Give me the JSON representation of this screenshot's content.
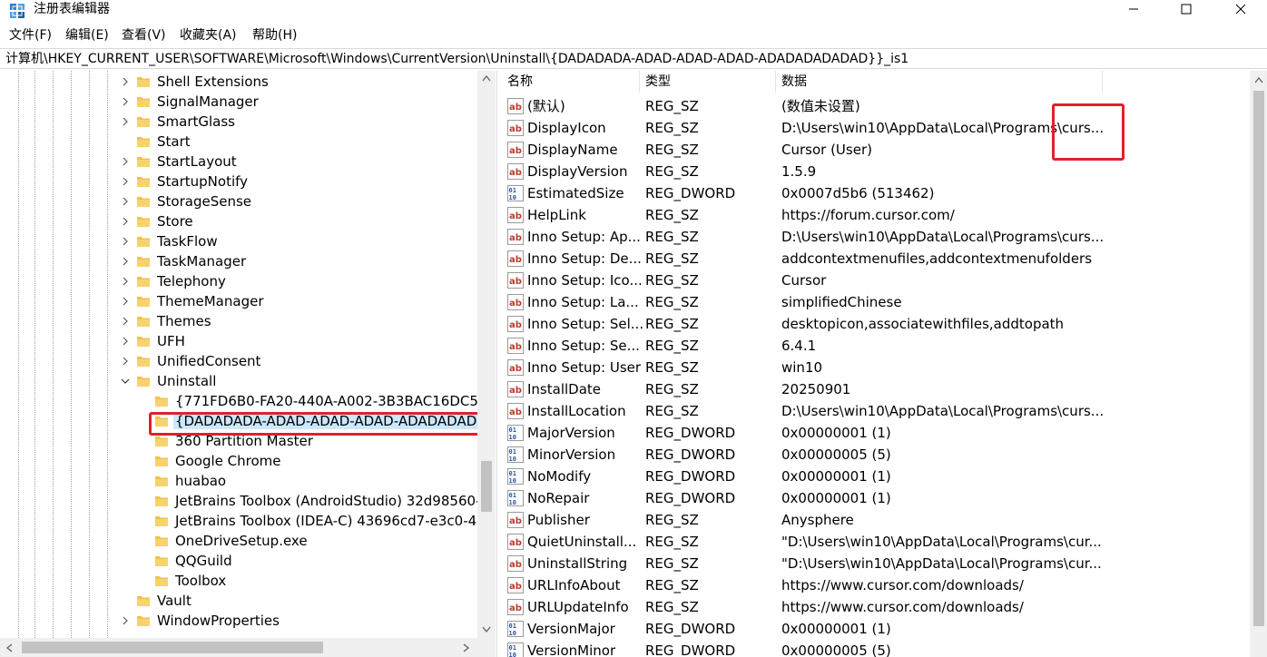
{
  "window": {
    "title": "注册表编辑器",
    "minimize_icon": "minimize-icon",
    "maximize_icon": "maximize-icon",
    "close_icon": "close-icon"
  },
  "menu": [
    {
      "label": "文件(F)"
    },
    {
      "label": "编辑(E)"
    },
    {
      "label": "查看(V)"
    },
    {
      "label": "收藏夹(A)"
    },
    {
      "label": "帮助(H)"
    }
  ],
  "address": "计算机\\HKEY_CURRENT_USER\\SOFTWARE\\Microsoft\\Windows\\CurrentVersion\\Uninstall\\{DADADADA-ADAD-ADAD-ADAD-ADADADADADAD}}_is1",
  "colors": {
    "folder": "#f2c14e",
    "selection": "#cce8ff",
    "highlight": "#e0212b",
    "string_icon": "#c0392b",
    "dword_icon": "#2455a4"
  },
  "tree": {
    "items": [
      {
        "label": "Shell Extensions",
        "expander": "collapsed"
      },
      {
        "label": "SignalManager",
        "expander": "collapsed"
      },
      {
        "label": "SmartGlass",
        "expander": "collapsed"
      },
      {
        "label": "Start",
        "expander": "none"
      },
      {
        "label": "StartLayout",
        "expander": "collapsed"
      },
      {
        "label": "StartupNotify",
        "expander": "collapsed"
      },
      {
        "label": "StorageSense",
        "expander": "collapsed"
      },
      {
        "label": "Store",
        "expander": "collapsed"
      },
      {
        "label": "TaskFlow",
        "expander": "collapsed"
      },
      {
        "label": "TaskManager",
        "expander": "collapsed"
      },
      {
        "label": "Telephony",
        "expander": "collapsed"
      },
      {
        "label": "ThemeManager",
        "expander": "collapsed"
      },
      {
        "label": "Themes",
        "expander": "collapsed"
      },
      {
        "label": "UFH",
        "expander": "collapsed"
      },
      {
        "label": "UnifiedConsent",
        "expander": "collapsed"
      },
      {
        "label": "Uninstall",
        "expander": "expanded"
      },
      {
        "label": "{771FD6B0-FA20-440A-A002-3B3BAC16DC50}",
        "expander": "none",
        "child": true
      },
      {
        "label": "{DADADADA-ADAD-ADAD-ADAD-ADADADAD",
        "expander": "none",
        "child": true,
        "selected": true
      },
      {
        "label": "360 Partition Master",
        "expander": "none",
        "child": true
      },
      {
        "label": "Google Chrome",
        "expander": "none",
        "child": true
      },
      {
        "label": "huabao",
        "expander": "none",
        "child": true
      },
      {
        "label": "JetBrains Toolbox (AndroidStudio) 32d98560-",
        "expander": "none",
        "child": true
      },
      {
        "label": "JetBrains Toolbox (IDEA-C) 43696cd7-e3c0-40",
        "expander": "none",
        "child": true
      },
      {
        "label": "OneDriveSetup.exe",
        "expander": "none",
        "child": true
      },
      {
        "label": "QQGuild",
        "expander": "none",
        "child": true
      },
      {
        "label": "Toolbox",
        "expander": "none",
        "child": true
      },
      {
        "label": "Vault",
        "expander": "none"
      },
      {
        "label": "WindowProperties",
        "expander": "collapsed"
      }
    ]
  },
  "values": {
    "headers": {
      "name": "名称",
      "type": "类型",
      "data": "数据"
    },
    "rows": [
      {
        "kind": "string",
        "name": "(默认)",
        "type": "REG_SZ",
        "data": "(数值未设置)"
      },
      {
        "kind": "string",
        "name": "DisplayIcon",
        "type": "REG_SZ",
        "data": "D:\\Users\\win10\\AppData\\Local\\Programs\\curs..."
      },
      {
        "kind": "string",
        "name": "DisplayName",
        "type": "REG_SZ",
        "data": "Cursor (User)"
      },
      {
        "kind": "string",
        "name": "DisplayVersion",
        "type": "REG_SZ",
        "data": "1.5.9"
      },
      {
        "kind": "dword",
        "name": "EstimatedSize",
        "type": "REG_DWORD",
        "data": "0x0007d5b6 (513462)"
      },
      {
        "kind": "string",
        "name": "HelpLink",
        "type": "REG_SZ",
        "data": "https://forum.cursor.com/"
      },
      {
        "kind": "string",
        "name": "Inno Setup: Ap...",
        "type": "REG_SZ",
        "data": "D:\\Users\\win10\\AppData\\Local\\Programs\\curs..."
      },
      {
        "kind": "string",
        "name": "Inno Setup: De...",
        "type": "REG_SZ",
        "data": "addcontextmenufiles,addcontextmenufolders"
      },
      {
        "kind": "string",
        "name": "Inno Setup: Ico...",
        "type": "REG_SZ",
        "data": "Cursor"
      },
      {
        "kind": "string",
        "name": "Inno Setup: La...",
        "type": "REG_SZ",
        "data": "simplifiedChinese"
      },
      {
        "kind": "string",
        "name": "Inno Setup: Sel...",
        "type": "REG_SZ",
        "data": "desktopicon,associatewithfiles,addtopath"
      },
      {
        "kind": "string",
        "name": "Inno Setup: Se...",
        "type": "REG_SZ",
        "data": "6.4.1"
      },
      {
        "kind": "string",
        "name": "Inno Setup: User",
        "type": "REG_SZ",
        "data": "win10"
      },
      {
        "kind": "string",
        "name": "InstallDate",
        "type": "REG_SZ",
        "data": "20250901"
      },
      {
        "kind": "string",
        "name": "InstallLocation",
        "type": "REG_SZ",
        "data": "D:\\Users\\win10\\AppData\\Local\\Programs\\curs..."
      },
      {
        "kind": "dword",
        "name": "MajorVersion",
        "type": "REG_DWORD",
        "data": "0x00000001 (1)"
      },
      {
        "kind": "dword",
        "name": "MinorVersion",
        "type": "REG_DWORD",
        "data": "0x00000005 (5)"
      },
      {
        "kind": "dword",
        "name": "NoModify",
        "type": "REG_DWORD",
        "data": "0x00000001 (1)"
      },
      {
        "kind": "dword",
        "name": "NoRepair",
        "type": "REG_DWORD",
        "data": "0x00000001 (1)"
      },
      {
        "kind": "string",
        "name": "Publisher",
        "type": "REG_SZ",
        "data": "Anysphere"
      },
      {
        "kind": "string",
        "name": "QuietUninstall...",
        "type": "REG_SZ",
        "data": "\"D:\\Users\\win10\\AppData\\Local\\Programs\\cur..."
      },
      {
        "kind": "string",
        "name": "UninstallString",
        "type": "REG_SZ",
        "data": "\"D:\\Users\\win10\\AppData\\Local\\Programs\\cur..."
      },
      {
        "kind": "string",
        "name": "URLInfoAbout",
        "type": "REG_SZ",
        "data": "https://www.cursor.com/downloads/"
      },
      {
        "kind": "string",
        "name": "URLUpdateInfo",
        "type": "REG_SZ",
        "data": "https://www.cursor.com/downloads/"
      },
      {
        "kind": "dword",
        "name": "VersionMajor",
        "type": "REG_DWORD",
        "data": "0x00000001 (1)"
      },
      {
        "kind": "dword",
        "name": "VersionMinor",
        "type": "REG_DWORD",
        "data": "0x00000005 (5)"
      }
    ]
  }
}
